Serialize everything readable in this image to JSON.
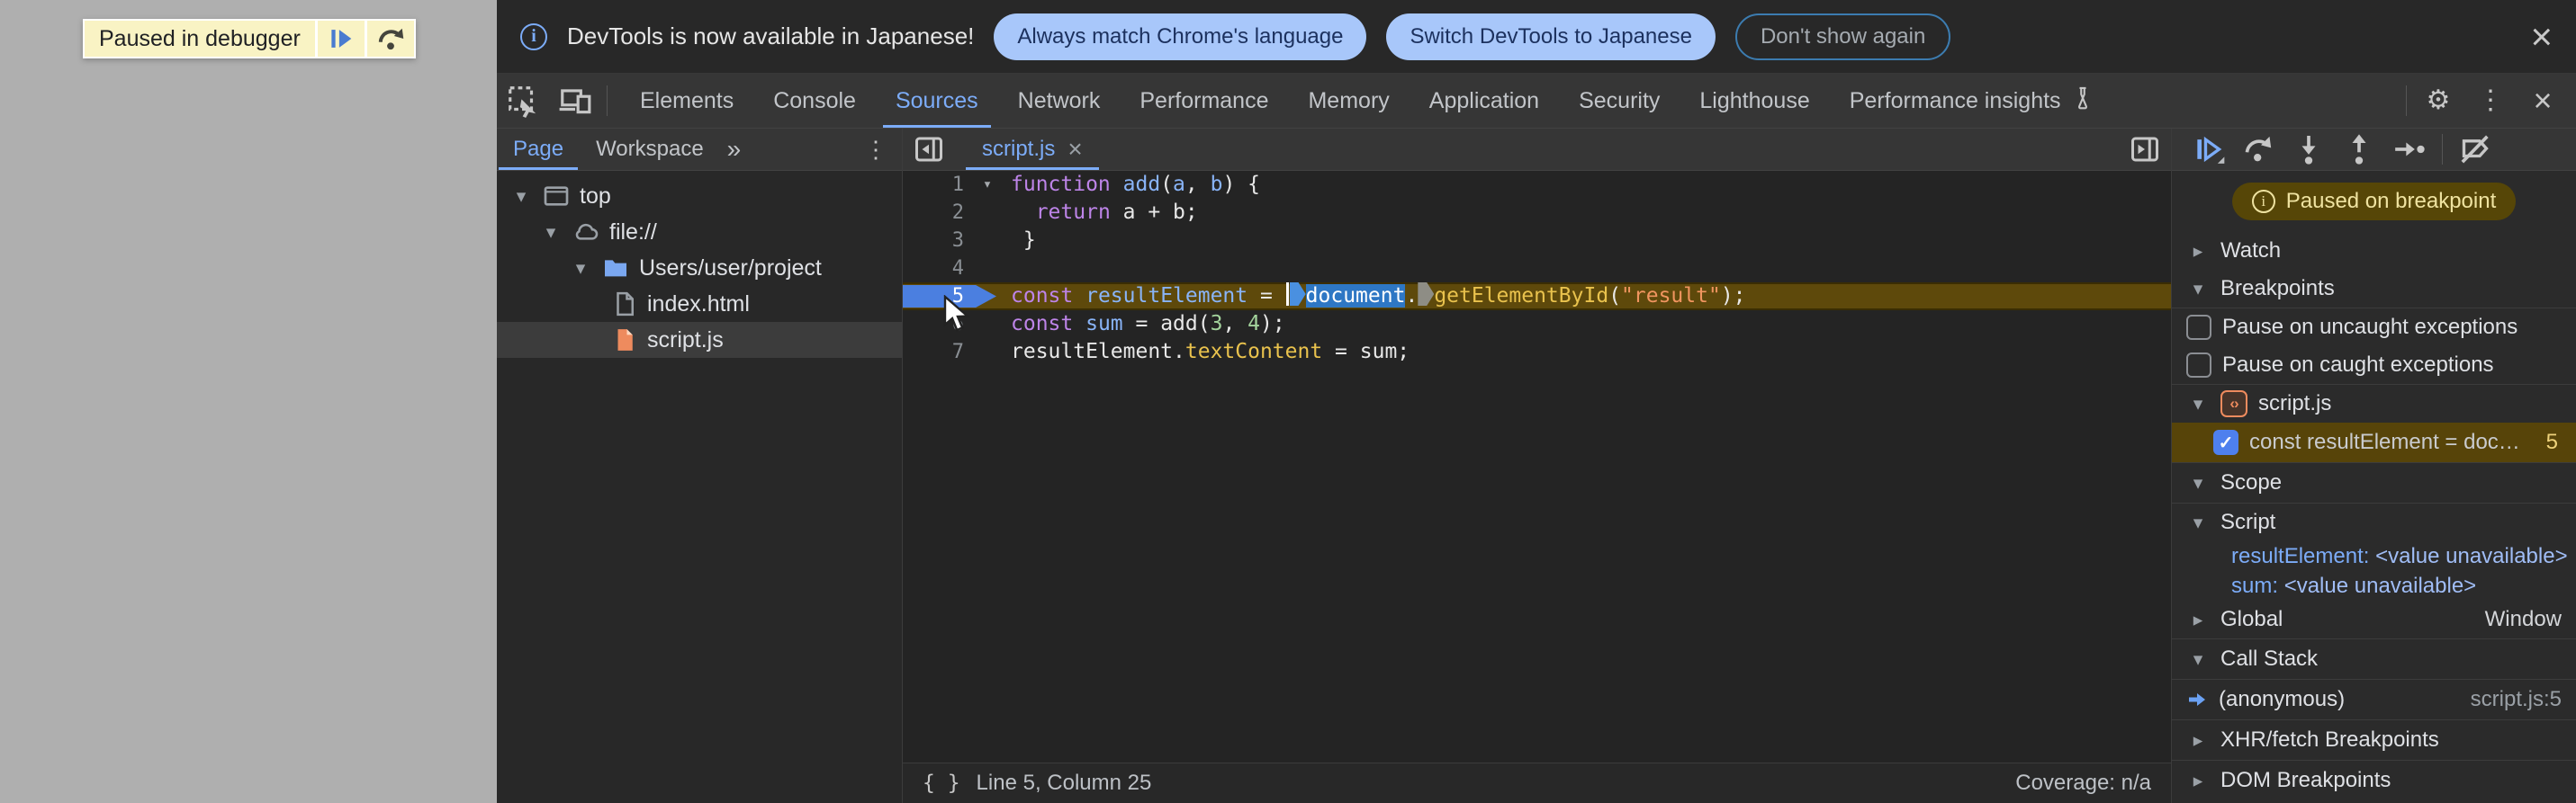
{
  "colors": {
    "accent_blue": "#7cacf8",
    "action_button_bg": "#a8c7fa",
    "action_button_fg": "#1c315e",
    "paused_banner_bg": "#f9f3c4",
    "exec_line_bg": "#5e490b",
    "breakpoint_row_bg": "#574409",
    "selection_blue": "#2e77c4",
    "paused_pill_bg": "#564607",
    "paused_pill_fg": "#efe3a1"
  },
  "icons": {
    "close": "×",
    "gear": "⚙",
    "more_vertical": "⋮",
    "more_tabs": "»",
    "caret_down": "▾",
    "caret_right": "▸",
    "braces": "{ }"
  },
  "page": {
    "paused_banner": {
      "label": "Paused in debugger"
    }
  },
  "notification": {
    "message": "DevTools is now available in Japanese!",
    "actions": [
      "Always match Chrome's language",
      "Switch DevTools to Japanese",
      "Don't show again"
    ]
  },
  "tabs": {
    "selected": "Sources",
    "items": [
      {
        "label": "Elements"
      },
      {
        "label": "Console"
      },
      {
        "label": "Sources"
      },
      {
        "label": "Network"
      },
      {
        "label": "Performance"
      },
      {
        "label": "Memory"
      },
      {
        "label": "Application"
      },
      {
        "label": "Security"
      },
      {
        "label": "Lighthouse"
      },
      {
        "label": "Performance insights",
        "icon": "flask"
      }
    ]
  },
  "navigator": {
    "tabs": [
      "Page",
      "Workspace"
    ],
    "selected": "Page",
    "tree": [
      {
        "label": "top",
        "icon": "frame",
        "depth": 0,
        "expanded": true
      },
      {
        "label": "file://",
        "icon": "cloud",
        "depth": 1,
        "expanded": true
      },
      {
        "label": "Users/user/project",
        "icon": "folder",
        "depth": 2,
        "expanded": true
      },
      {
        "label": "index.html",
        "icon": "file-html",
        "depth": 3
      },
      {
        "label": "script.js",
        "icon": "file-js",
        "depth": 3,
        "selected": true
      }
    ]
  },
  "editor": {
    "open_tab": "script.js",
    "status": {
      "cursor": "Line 5, Column 25",
      "coverage": "Coverage: n/a"
    },
    "lines": [
      {
        "num": 1,
        "fold": true,
        "tokens": [
          {
            "t": "function",
            "c": "kw"
          },
          {
            "t": " ",
            "c": "pl"
          },
          {
            "t": "add",
            "c": "def"
          },
          {
            "t": "(",
            "c": "pl"
          },
          {
            "t": "a",
            "c": "def"
          },
          {
            "t": ", ",
            "c": "pl"
          },
          {
            "t": "b",
            "c": "def"
          },
          {
            "t": ") {",
            "c": "pl"
          }
        ]
      },
      {
        "num": 2,
        "tokens": [
          {
            "t": "  ",
            "c": "pl"
          },
          {
            "t": "return",
            "c": "kw"
          },
          {
            "t": " a + b;",
            "c": "pl"
          }
        ]
      },
      {
        "num": 3,
        "tokens": [
          {
            "t": " }",
            "c": "pl"
          }
        ]
      },
      {
        "num": 4,
        "tokens": []
      },
      {
        "num": 5,
        "exec": true,
        "tokens": [
          {
            "t": "const",
            "c": "kw"
          },
          {
            "t": " ",
            "c": "pl"
          },
          {
            "t": "resultElement",
            "c": "def"
          },
          {
            "t": " = ",
            "c": "pl"
          },
          {
            "t": "",
            "c": "cursor"
          },
          {
            "t": "",
            "c": "marker-blue"
          },
          {
            "t": "document",
            "c": "sel"
          },
          {
            "t": ".",
            "c": "pl"
          },
          {
            "t": "",
            "c": "marker-gray"
          },
          {
            "t": "getElementById",
            "c": "prop"
          },
          {
            "t": "(",
            "c": "pl"
          },
          {
            "t": "\"result\"",
            "c": "str"
          },
          {
            "t": ");",
            "c": "pl"
          }
        ]
      },
      {
        "num": 6,
        "tokens": [
          {
            "t": "const",
            "c": "kw"
          },
          {
            "t": " ",
            "c": "pl"
          },
          {
            "t": "sum",
            "c": "def"
          },
          {
            "t": " = add(",
            "c": "pl"
          },
          {
            "t": "3",
            "c": "num"
          },
          {
            "t": ", ",
            "c": "pl"
          },
          {
            "t": "4",
            "c": "num"
          },
          {
            "t": ");",
            "c": "pl"
          }
        ]
      },
      {
        "num": 7,
        "tokens": [
          {
            "t": "resultElement.",
            "c": "pl"
          },
          {
            "t": "textContent",
            "c": "prop"
          },
          {
            "t": " = sum;",
            "c": "pl"
          }
        ]
      }
    ]
  },
  "debugger": {
    "paused_message": "Paused on breakpoint",
    "watch_label": "Watch",
    "breakpoints_label": "Breakpoints",
    "pause_uncaught": "Pause on uncaught exceptions",
    "pause_caught": "Pause on caught exceptions",
    "breakpoint_group": {
      "file": "script.js",
      "entry": {
        "code": "const resultElement = doc…",
        "line": "5",
        "checked": true
      }
    },
    "scope": {
      "label": "Scope",
      "script_label": "Script",
      "vars": [
        {
          "name": "resultElement",
          "value": "<value unavailable>"
        },
        {
          "name": "sum",
          "value": "<value unavailable>"
        }
      ],
      "global_label": "Global",
      "global_value": "Window"
    },
    "call_stack": {
      "label": "Call Stack",
      "frame": {
        "fn": "(anonymous)",
        "location": "script.js:5"
      }
    },
    "xhr_label": "XHR/fetch Breakpoints",
    "dom_label": "DOM Breakpoints"
  }
}
